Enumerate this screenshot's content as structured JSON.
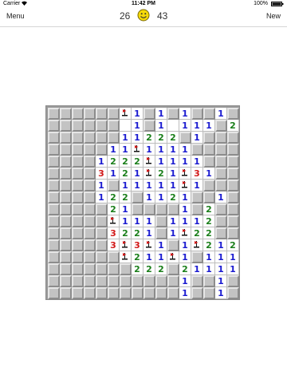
{
  "status_bar": {
    "carrier": "Carrier",
    "time": "11:42 PM",
    "battery": "100%"
  },
  "nav": {
    "menu_label": "Menu",
    "new_label": "New",
    "mines_remaining": "26",
    "timer": "43",
    "smiley_icon": "smiley-face-icon"
  },
  "colors": {
    "num1": "#1a1ad0",
    "num2": "#1b7f1b",
    "num3": "#d21a1a",
    "flag": "#d21a1a",
    "hidden": "#c3c3c3",
    "open": "#ffffff",
    "smiley": "#f5d90a"
  },
  "board": {
    "rows": 16,
    "cols": 16,
    "legend": "H = hidden, 0 = open empty, 1-3 = number, F = flag",
    "cells": [
      "HHHHHHF1H1H1HH1H",
      "HHHHHH01H10111H2",
      "HHHHHH11222H1HHH",
      "HHHHH11F1111HHHH",
      "HHHH1222F1111HHH",
      "HHHH3121F21F31HH",
      "HHHH1H11111F1HHH",
      "HHHH122H1121HH1H",
      "HHHHH21HHHH1H2HH",
      "HHHHHF111H1112HH",
      "HHHHH3221H1F22HH",
      "HHHHH3F3F1H1F2121",
      "HHHHHHF211F1H111",
      "HHHHHHH222H21111",
      "HHHHHHHHHHH1HH1H",
      "HHHHHHHHHHH1HH1H"
    ]
  }
}
